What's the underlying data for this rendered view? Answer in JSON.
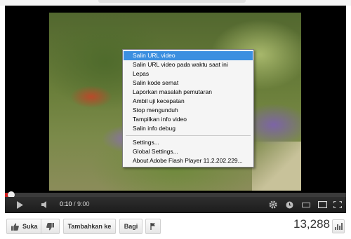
{
  "context_menu": {
    "items": [
      {
        "label": "Salin URL video",
        "highlighted": true
      },
      {
        "label": "Salin URL video pada waktu saat ini"
      },
      {
        "label": "Lepas"
      },
      {
        "label": "Salin kode semat"
      },
      {
        "label": "Laporkan masalah pemutaran"
      },
      {
        "label": "Ambil uji kecepatan"
      },
      {
        "label": "Stop mengunduh"
      },
      {
        "label": "Tampilkan info video"
      },
      {
        "label": "Salin info debug"
      }
    ],
    "flash_items": [
      {
        "label": "Settings..."
      },
      {
        "label": "Global Settings..."
      },
      {
        "label": "About Adobe Flash Player 11.2.202.229..."
      }
    ]
  },
  "player": {
    "current_time": "0:10",
    "separator": " / ",
    "duration": "9:00",
    "progress_fraction": 0.0185,
    "progress_color": "#d31f1f"
  },
  "actions": {
    "like_label": "Suka",
    "add_to_label": "Tambahkan ke",
    "share_label": "Bagi",
    "view_count": "13,288"
  },
  "icons": [
    "play-icon",
    "volume-icon",
    "gear-icon",
    "clock-icon",
    "small-player-icon",
    "large-player-icon",
    "fullscreen-icon",
    "thumbs-up-icon",
    "thumbs-down-icon",
    "flag-icon",
    "stats-icon"
  ],
  "colors": {
    "highlight": "#3b8fe0",
    "accent": "#d31f1f"
  }
}
